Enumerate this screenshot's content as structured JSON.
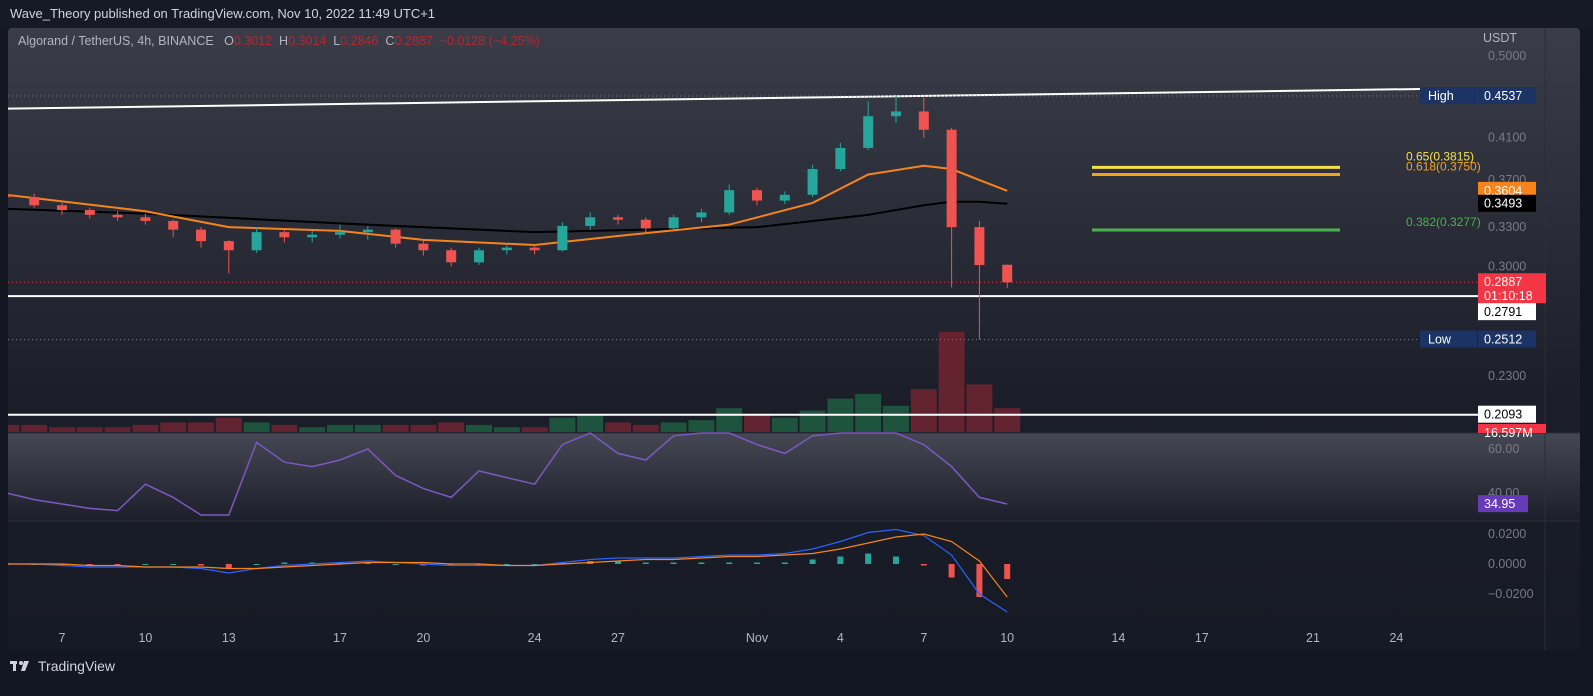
{
  "header": {
    "publisher": "Wave_Theory published on TradingView.com, Nov 10, 2022 11:49 UTC+1"
  },
  "legend": {
    "symbol": "Algorand / TetherUS, 4h, BINANCE",
    "o_label": "O",
    "o": "0.3012",
    "h_label": "H",
    "h": "0.3014",
    "l_label": "L",
    "l": "0.2846",
    "c_label": "C",
    "c": "0.2887",
    "change": "−0.0128 (−4.25%)"
  },
  "footer": {
    "brand": "TradingView"
  },
  "colors": {
    "up": "#26a69a",
    "down": "#ef5350",
    "ema": "#f7841b",
    "ma": "#000000",
    "rsi": "#7e57c2",
    "macd": "#2962ff",
    "signal": "#f7841b",
    "fib65": "#f5e04a",
    "fib618": "#f7a21b",
    "fib382": "#4caf50"
  },
  "chart_data": {
    "type": "candlestick",
    "title": "Algorand / TetherUS, 4h, BINANCE",
    "currency": "USDT",
    "scale": "log",
    "y_ticks": [
      "0.5000",
      "0.4100",
      "0.3700",
      "0.3300",
      "0.3000",
      "0.2300"
    ],
    "x_ticks": [
      {
        "label": "7",
        "day": 7
      },
      {
        "label": "10",
        "day": 10
      },
      {
        "label": "13",
        "day": 13
      },
      {
        "label": "17",
        "day": 17
      },
      {
        "label": "20",
        "day": 20
      },
      {
        "label": "24",
        "day": 24
      },
      {
        "label": "27",
        "day": 27
      },
      {
        "label": "Nov",
        "day": 32
      },
      {
        "label": "4",
        "day": 35
      },
      {
        "label": "7",
        "day": 38
      },
      {
        "label": "10",
        "day": 41
      },
      {
        "label": "14",
        "day": 45
      },
      {
        "label": "17",
        "day": 48
      },
      {
        "label": "21",
        "day": 52
      },
      {
        "label": "24",
        "day": 55
      }
    ],
    "candles_daily_ohlc": [
      [
        0.357,
        0.36,
        0.352,
        0.355
      ],
      [
        0.355,
        0.358,
        0.346,
        0.348
      ],
      [
        0.348,
        0.35,
        0.34,
        0.344
      ],
      [
        0.344,
        0.346,
        0.337,
        0.34
      ],
      [
        0.34,
        0.343,
        0.335,
        0.338
      ],
      [
        0.338,
        0.341,
        0.332,
        0.335
      ],
      [
        0.335,
        0.336,
        0.322,
        0.328
      ],
      [
        0.328,
        0.33,
        0.314,
        0.319
      ],
      [
        0.319,
        0.32,
        0.295,
        0.312
      ],
      [
        0.312,
        0.33,
        0.31,
        0.326
      ],
      [
        0.326,
        0.328,
        0.318,
        0.322
      ],
      [
        0.322,
        0.327,
        0.318,
        0.324
      ],
      [
        0.324,
        0.332,
        0.321,
        0.326
      ],
      [
        0.326,
        0.331,
        0.32,
        0.328
      ],
      [
        0.328,
        0.329,
        0.314,
        0.317
      ],
      [
        0.317,
        0.319,
        0.308,
        0.312
      ],
      [
        0.312,
        0.314,
        0.3,
        0.303
      ],
      [
        0.303,
        0.314,
        0.301,
        0.312
      ],
      [
        0.312,
        0.316,
        0.309,
        0.314
      ],
      [
        0.314,
        0.316,
        0.309,
        0.312
      ],
      [
        0.312,
        0.334,
        0.311,
        0.331
      ],
      [
        0.331,
        0.342,
        0.328,
        0.338
      ],
      [
        0.338,
        0.34,
        0.332,
        0.336
      ],
      [
        0.336,
        0.338,
        0.325,
        0.329
      ],
      [
        0.329,
        0.34,
        0.328,
        0.338
      ],
      [
        0.338,
        0.345,
        0.334,
        0.342
      ],
      [
        0.342,
        0.366,
        0.34,
        0.361
      ],
      [
        0.361,
        0.363,
        0.348,
        0.352
      ],
      [
        0.352,
        0.36,
        0.349,
        0.357
      ],
      [
        0.357,
        0.384,
        0.355,
        0.38
      ],
      [
        0.38,
        0.405,
        0.378,
        0.4
      ],
      [
        0.4,
        0.448,
        0.398,
        0.432
      ],
      [
        0.432,
        0.4537,
        0.425,
        0.437
      ],
      [
        0.437,
        0.452,
        0.41,
        0.418
      ],
      [
        0.418,
        0.42,
        0.285,
        0.33
      ],
      [
        0.33,
        0.335,
        0.2512,
        0.301
      ],
      [
        0.3012,
        0.3014,
        0.2846,
        0.2887
      ]
    ],
    "first_day": 5,
    "ema": {
      "name": "EMA",
      "last": "0.3604",
      "points": [
        [
          5,
          0.357
        ],
        [
          10,
          0.343
        ],
        [
          13,
          0.33
        ],
        [
          17,
          0.327
        ],
        [
          20,
          0.32
        ],
        [
          24,
          0.316
        ],
        [
          27,
          0.323
        ],
        [
          31,
          0.332
        ],
        [
          34,
          0.35
        ],
        [
          36,
          0.375
        ],
        [
          38,
          0.383
        ],
        [
          39,
          0.38
        ],
        [
          40,
          0.37
        ],
        [
          41,
          0.3604
        ]
      ]
    },
    "ma": {
      "name": "MA",
      "last": "0.3493",
      "points": [
        [
          5,
          0.345
        ],
        [
          10,
          0.341
        ],
        [
          17,
          0.333
        ],
        [
          24,
          0.326
        ],
        [
          32,
          0.33
        ],
        [
          36,
          0.34
        ],
        [
          38,
          0.348
        ],
        [
          39,
          0.351
        ],
        [
          40,
          0.351
        ],
        [
          41,
          0.3493
        ]
      ]
    },
    "levels": {
      "high": {
        "label": "High",
        "value": "0.4537"
      },
      "low": {
        "label": "Low",
        "value": "0.2512"
      },
      "last": {
        "value": "0.2887",
        "countdown": "01:10:18"
      },
      "support1": "0.2791",
      "support2": "0.2093"
    },
    "trendline": [
      [
        5,
        0.44
      ],
      [
        57,
        0.462
      ]
    ],
    "fib": [
      {
        "label": "0.65(0.3815)",
        "value": 0.3815
      },
      {
        "label": "0.618(0.3750)",
        "value": 0.375
      },
      {
        "label": "0.382(0.3277)",
        "value": 0.3277
      }
    ],
    "volume": {
      "last_label": "16.597M",
      "values_m": [
        3,
        3,
        2,
        2,
        2,
        3,
        4,
        4,
        6,
        4,
        3,
        2,
        3,
        3,
        3,
        3,
        4,
        3,
        2,
        2,
        6,
        7,
        4,
        3,
        4,
        5,
        10,
        7,
        6,
        9,
        14,
        16,
        11,
        18,
        42,
        20,
        10
      ]
    },
    "rsi": {
      "ticks": [
        "60.00",
        "40.00"
      ],
      "last": "34.95",
      "values": [
        40,
        37,
        35,
        33,
        32,
        44,
        38,
        30,
        30,
        63,
        54,
        52,
        55,
        60,
        48,
        42,
        38,
        50,
        47,
        44,
        62,
        70,
        58,
        55,
        66,
        68,
        68,
        62,
        58,
        66,
        72,
        70,
        68,
        62,
        52,
        38,
        35
      ]
    },
    "macd": {
      "ticks": [
        "0.0200",
        "0.0000",
        "−0.0200"
      ],
      "macd": [
        0,
        0,
        -0.001,
        -0.002,
        -0.002,
        -0.002,
        -0.002,
        -0.003,
        -0.006,
        -0.003,
        -0.001,
        0,
        0.001,
        0.002,
        0.001,
        0,
        -0.001,
        -0.001,
        -0.001,
        -0.001,
        0.001,
        0.003,
        0.004,
        0.004,
        0.004,
        0.005,
        0.006,
        0.006,
        0.007,
        0.01,
        0.015,
        0.021,
        0.023,
        0.019,
        0.006,
        -0.02,
        -0.032
      ],
      "signal": [
        0,
        0,
        0,
        -0.001,
        -0.001,
        -0.002,
        -0.002,
        -0.002,
        -0.003,
        -0.003,
        -0.002,
        -0.001,
        0,
        0.001,
        0.001,
        0.001,
        0,
        0,
        -0.001,
        -0.001,
        0,
        0.001,
        0.002,
        0.003,
        0.003,
        0.004,
        0.005,
        0.005,
        0.006,
        0.007,
        0.01,
        0.014,
        0.018,
        0.02,
        0.015,
        0.002,
        -0.022
      ]
    }
  }
}
